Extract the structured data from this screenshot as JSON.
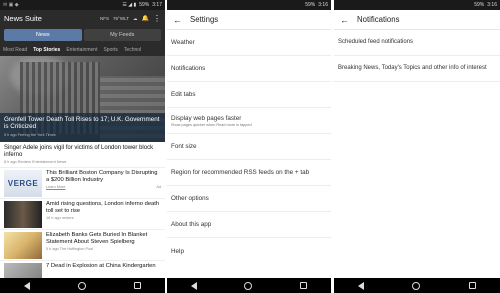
{
  "panel1": {
    "status": {
      "notif": "✉ ▣ ◆",
      "icons": "☰ ◢ ▮",
      "battery": "59%",
      "time": "3:17"
    },
    "header": {
      "title": "News Suite",
      "mini_left": "NFS",
      "mini_mid": "76°WLT"
    },
    "segments": [
      "News",
      "My Feeds"
    ],
    "categories": [
      "Most Read",
      "Top Stories",
      "Entertainment",
      "Sports",
      "Technol"
    ],
    "selected_category": "Top Stories",
    "hero": {
      "headline": "Grenfell Tower Death Toll Rises to 17; U.K. Government is Criticized",
      "meta": "5 h ago   Ferring the York Times"
    },
    "story1": {
      "headline": "Singer Adele joins vigil for victims of London tower block inferno",
      "meta": "8 h ago   Reuters Entertainment News"
    },
    "rows": [
      {
        "headline": "This Brilliant Boston Company Is Disrupting a $200 Billion Industry",
        "meta": "Learn More",
        "ad": "Ad",
        "thumb_text": "VERGE"
      },
      {
        "headline": "Amid rising questions, London inferno death toll set to rise",
        "meta": "16 h ago   reuters",
        "ad": ""
      },
      {
        "headline": "Elizabeth Banks Gets Buried In Blanket Statement About Steven Spielberg",
        "meta": "5 h ago   The Huffington Post",
        "ad": ""
      },
      {
        "headline": "7 Dead in Explosion at China Kindergarten",
        "meta": "",
        "ad": ""
      }
    ]
  },
  "panel2": {
    "status": {
      "battery": "59%",
      "time": "3:16"
    },
    "title": "Settings",
    "items": [
      {
        "label": "Weather",
        "sub": ""
      },
      {
        "label": "Notifications",
        "sub": ""
      },
      {
        "label": "Edit tabs",
        "sub": ""
      },
      {
        "label": "Display web pages faster",
        "sub": "Show pages quicker when Read more is tapped"
      },
      {
        "label": "Font size",
        "sub": ""
      },
      {
        "label": "Region for recommended RSS feeds on the + tab",
        "sub": ""
      },
      {
        "label": "Other options",
        "sub": ""
      },
      {
        "label": "About this app",
        "sub": ""
      },
      {
        "label": "Help",
        "sub": ""
      }
    ]
  },
  "panel3": {
    "status": {
      "battery": "59%",
      "time": "3:16"
    },
    "title": "Notifications",
    "items": [
      "Scheduled feed notifications",
      "Breaking News, Today's Topics and other info of interest"
    ]
  }
}
